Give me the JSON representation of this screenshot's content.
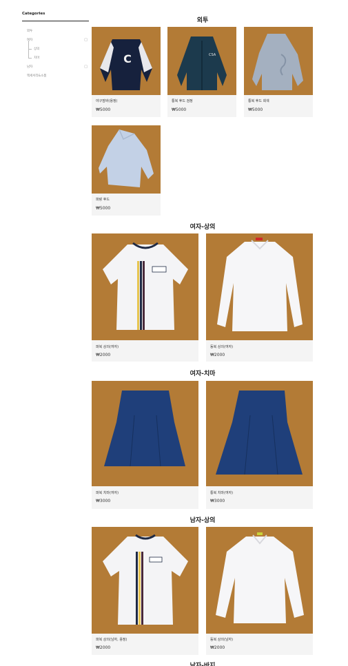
{
  "sidebar": {
    "title": "Categories",
    "items": [
      {
        "label": "외투",
        "toggle": ""
      },
      {
        "label": "여자",
        "toggle": "□"
      },
      {
        "label": "상의",
        "toggle": ""
      },
      {
        "label": "치마",
        "toggle": ""
      },
      {
        "label": "남자",
        "toggle": "□"
      },
      {
        "label": "액세서리&소품",
        "toggle": ""
      }
    ]
  },
  "sections": [
    {
      "title": "외투",
      "products": [
        {
          "name": "야구잠바(용정)",
          "price": "₩5000",
          "photo": "varsity-jacket"
        },
        {
          "name": "통복 후드 검정",
          "price": "₩5000",
          "photo": "navy-zip-hoodie"
        },
        {
          "name": "통복 후드 회색",
          "price": "₩5000",
          "photo": "gray-hoodie"
        },
        {
          "name": "파랑 후드",
          "price": "₩5000",
          "photo": "light-blue-hoodie"
        }
      ]
    },
    {
      "title": "여자-상의",
      "products": [
        {
          "name": "파복 상의(여자)",
          "price": "₩2000",
          "photo": "girls-short-sleeve-blouse"
        },
        {
          "name": "동복 상의(여자)",
          "price": "₩2000",
          "photo": "girls-long-sleeve-blouse"
        }
      ]
    },
    {
      "title": "여자-치마",
      "products": [
        {
          "name": "파복 치마(여자)",
          "price": "₩3000",
          "photo": "navy-skirt"
        },
        {
          "name": "통복 치마(여자)",
          "price": "₩3000",
          "photo": "navy-skirt-2"
        }
      ]
    },
    {
      "title": "남자-상의",
      "products": [
        {
          "name": "파복 상의(남자, 용정)",
          "price": "₩2000",
          "photo": "boys-short-sleeve-shirt"
        },
        {
          "name": "동복 상의(남자)",
          "price": "₩2000",
          "photo": "boys-long-sleeve-shirt"
        }
      ]
    },
    {
      "title": "남자-바지",
      "products": []
    }
  ],
  "colors": {
    "floor": "#b07a35",
    "card_bg": "#f4f4f4",
    "navy": "#1f3f7a"
  }
}
